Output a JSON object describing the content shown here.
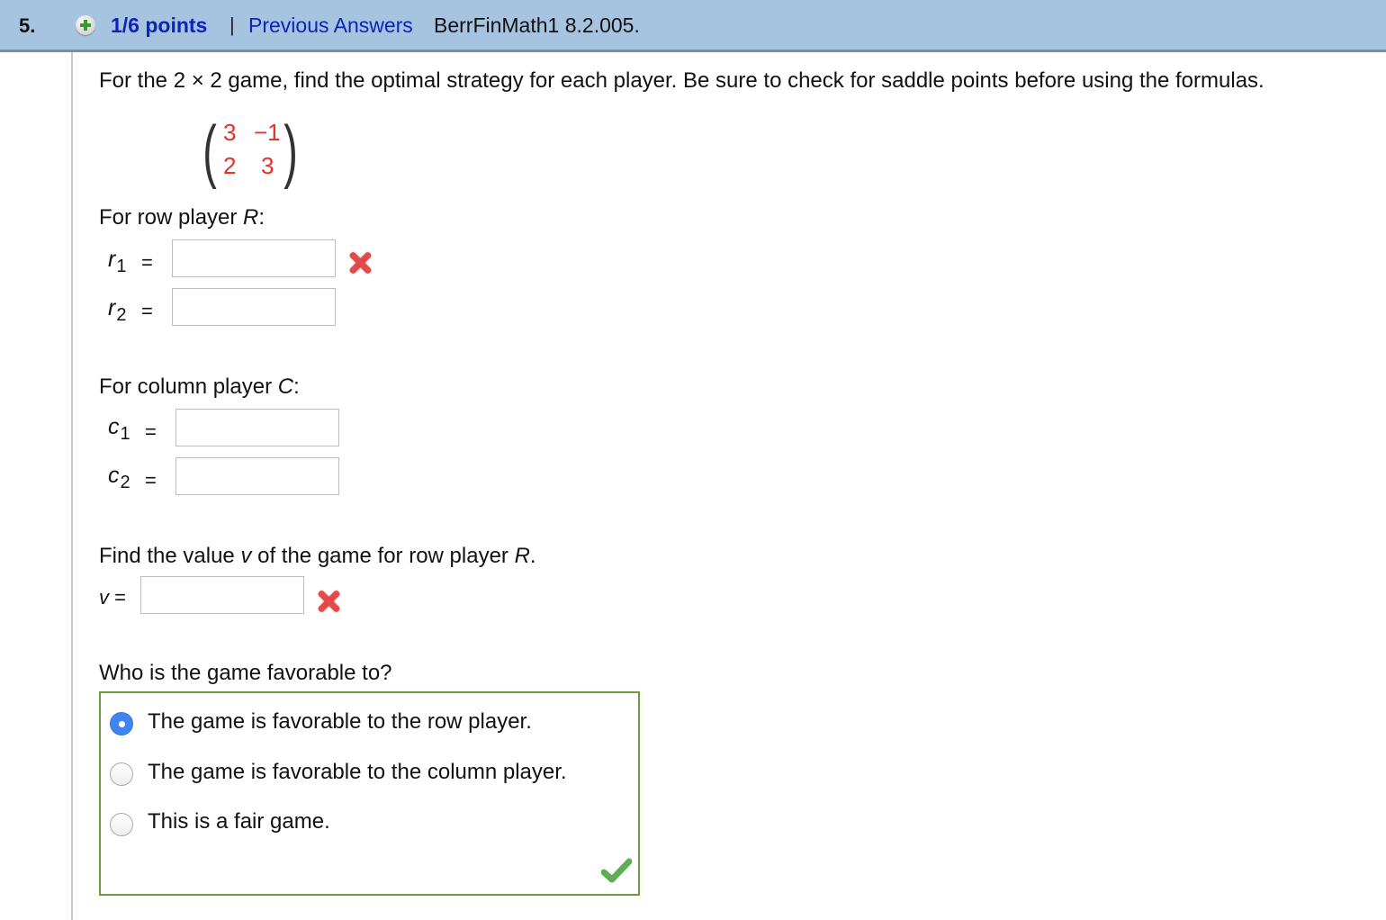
{
  "header": {
    "question_number": "5.",
    "status_icon": "plus-circle-icon",
    "points": "1/6 points",
    "separator": "|",
    "previous_answers_link": "Previous Answers",
    "problem_code": "BerrFinMath1 8.2.005."
  },
  "question": {
    "prompt": "For the 2 × 2 game, find the optimal strategy for each player. Be sure to check for saddle points before using the formulas.",
    "matrix": [
      [
        "3",
        "−1"
      ],
      [
        "2",
        "3"
      ]
    ],
    "row_player": {
      "heading_prefix": "For row player ",
      "heading_var": "R",
      "heading_suffix": ":",
      "fields": [
        {
          "var": "r",
          "sub": "1",
          "eq": "=",
          "value": "",
          "status": "incorrect"
        },
        {
          "var": "r",
          "sub": "2",
          "eq": "=",
          "value": "",
          "status": ""
        }
      ]
    },
    "column_player": {
      "heading_prefix": "For column player ",
      "heading_var": "C",
      "heading_suffix": ":",
      "fields": [
        {
          "var": "c",
          "sub": "1",
          "eq": "=",
          "value": ""
        },
        {
          "var": "c",
          "sub": "2",
          "eq": "=",
          "value": ""
        }
      ]
    },
    "value": {
      "prompt_prefix": "Find the value ",
      "prompt_var": "v",
      "prompt_middle": " of the game for row player ",
      "prompt_var2": "R",
      "prompt_suffix": ".",
      "label_var": "v",
      "label_eq": " =",
      "answer": "",
      "status": "incorrect"
    },
    "favorable": {
      "prompt": "Who is the game favorable to?",
      "options": [
        {
          "label": "The game is favorable to the row player.",
          "selected": true
        },
        {
          "label": "The game is favorable to the column player.",
          "selected": false
        },
        {
          "label": "This is a fair game.",
          "selected": false
        }
      ],
      "status": "correct"
    }
  },
  "colors": {
    "header_bg": "#a6c3df",
    "link": "#1122bb",
    "matrix_entries": "#e8302a",
    "incorrect": "#e34a4a",
    "correct_border": "#6c9b3d",
    "radio_selected": "#3f85f2"
  }
}
